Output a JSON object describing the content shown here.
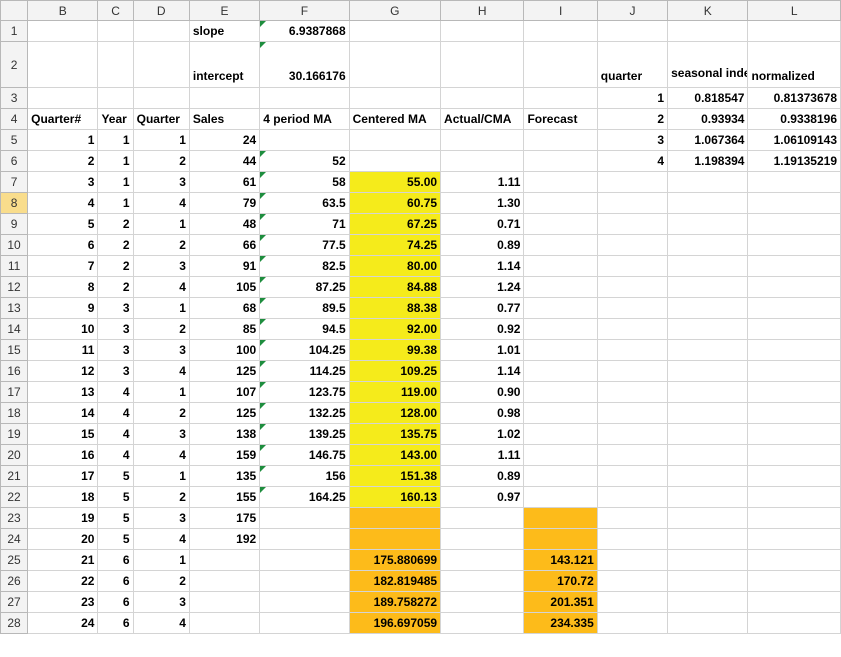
{
  "columns": [
    "B",
    "C",
    "D",
    "E",
    "F",
    "G",
    "H",
    "I",
    "J",
    "K",
    "L"
  ],
  "rows": [
    {
      "num": "1",
      "cells": [
        "",
        "",
        "",
        "slope",
        "6.9387868",
        "",
        "",
        "",
        "",
        "",
        ""
      ]
    },
    {
      "num": "2",
      "cells": [
        "",
        "",
        "",
        "intercept",
        "30.166176",
        "",
        "",
        "",
        "quarter",
        "seasonal index",
        "normalized"
      ]
    },
    {
      "num": "3",
      "cells": [
        "",
        "",
        "",
        "",
        "",
        "",
        "",
        "",
        "1",
        "0.818547",
        "0.81373678"
      ]
    },
    {
      "num": "4",
      "cells": [
        "Quarter#",
        "Year",
        "Quarter",
        "Sales",
        "4 period MA",
        "Centered MA",
        "Actual/CMA",
        "Forecast",
        "2",
        "0.93934",
        "0.9338196"
      ]
    },
    {
      "num": "5",
      "cells": [
        "1",
        "1",
        "1",
        "24",
        "",
        "",
        "",
        "",
        "3",
        "1.067364",
        "1.06109143"
      ]
    },
    {
      "num": "6",
      "cells": [
        "2",
        "1",
        "2",
        "44",
        "52",
        "",
        "",
        "",
        "4",
        "1.198394",
        "1.19135219"
      ]
    },
    {
      "num": "7",
      "cells": [
        "3",
        "1",
        "3",
        "61",
        "58",
        "55.00",
        "1.11",
        "",
        "",
        "",
        ""
      ]
    },
    {
      "num": "8",
      "cells": [
        "4",
        "1",
        "4",
        "79",
        "63.5",
        "60.75",
        "1.30",
        "",
        "",
        "",
        ""
      ]
    },
    {
      "num": "9",
      "cells": [
        "5",
        "2",
        "1",
        "48",
        "71",
        "67.25",
        "0.71",
        "",
        "",
        "",
        ""
      ]
    },
    {
      "num": "10",
      "cells": [
        "6",
        "2",
        "2",
        "66",
        "77.5",
        "74.25",
        "0.89",
        "",
        "",
        "",
        ""
      ]
    },
    {
      "num": "11",
      "cells": [
        "7",
        "2",
        "3",
        "91",
        "82.5",
        "80.00",
        "1.14",
        "",
        "",
        "",
        ""
      ]
    },
    {
      "num": "12",
      "cells": [
        "8",
        "2",
        "4",
        "105",
        "87.25",
        "84.88",
        "1.24",
        "",
        "",
        "",
        ""
      ]
    },
    {
      "num": "13",
      "cells": [
        "9",
        "3",
        "1",
        "68",
        "89.5",
        "88.38",
        "0.77",
        "",
        "",
        "",
        ""
      ]
    },
    {
      "num": "14",
      "cells": [
        "10",
        "3",
        "2",
        "85",
        "94.5",
        "92.00",
        "0.92",
        "",
        "",
        "",
        ""
      ]
    },
    {
      "num": "15",
      "cells": [
        "11",
        "3",
        "3",
        "100",
        "104.25",
        "99.38",
        "1.01",
        "",
        "",
        "",
        ""
      ]
    },
    {
      "num": "16",
      "cells": [
        "12",
        "3",
        "4",
        "125",
        "114.25",
        "109.25",
        "1.14",
        "",
        "",
        "",
        ""
      ]
    },
    {
      "num": "17",
      "cells": [
        "13",
        "4",
        "1",
        "107",
        "123.75",
        "119.00",
        "0.90",
        "",
        "",
        "",
        ""
      ]
    },
    {
      "num": "18",
      "cells": [
        "14",
        "4",
        "2",
        "125",
        "132.25",
        "128.00",
        "0.98",
        "",
        "",
        "",
        ""
      ]
    },
    {
      "num": "19",
      "cells": [
        "15",
        "4",
        "3",
        "138",
        "139.25",
        "135.75",
        "1.02",
        "",
        "",
        "",
        ""
      ]
    },
    {
      "num": "20",
      "cells": [
        "16",
        "4",
        "4",
        "159",
        "146.75",
        "143.00",
        "1.11",
        "",
        "",
        "",
        ""
      ]
    },
    {
      "num": "21",
      "cells": [
        "17",
        "5",
        "1",
        "135",
        "156",
        "151.38",
        "0.89",
        "",
        "",
        "",
        ""
      ]
    },
    {
      "num": "22",
      "cells": [
        "18",
        "5",
        "2",
        "155",
        "164.25",
        "160.13",
        "0.97",
        "",
        "",
        "",
        ""
      ]
    },
    {
      "num": "23",
      "cells": [
        "19",
        "5",
        "3",
        "175",
        "",
        "",
        "",
        "",
        "",
        "",
        ""
      ]
    },
    {
      "num": "24",
      "cells": [
        "20",
        "5",
        "4",
        "192",
        "",
        "",
        "",
        "",
        "",
        "",
        ""
      ]
    },
    {
      "num": "25",
      "cells": [
        "21",
        "6",
        "1",
        "",
        "",
        "175.880699",
        "",
        "143.121",
        "",
        "",
        ""
      ]
    },
    {
      "num": "26",
      "cells": [
        "22",
        "6",
        "2",
        "",
        "",
        "182.819485",
        "",
        "170.72",
        "",
        "",
        ""
      ]
    },
    {
      "num": "27",
      "cells": [
        "23",
        "6",
        "3",
        "",
        "",
        "189.758272",
        "",
        "201.351",
        "",
        "",
        ""
      ]
    },
    {
      "num": "28",
      "cells": [
        "24",
        "6",
        "4",
        "",
        "",
        "196.697059",
        "",
        "234.335",
        "",
        "",
        ""
      ]
    }
  ],
  "selected_row": "8",
  "colors": {
    "centered_ma_fill": "#f5eb1b",
    "forecast_fill": "#fdbb1a",
    "error_indicator": "#1e8d3e"
  }
}
